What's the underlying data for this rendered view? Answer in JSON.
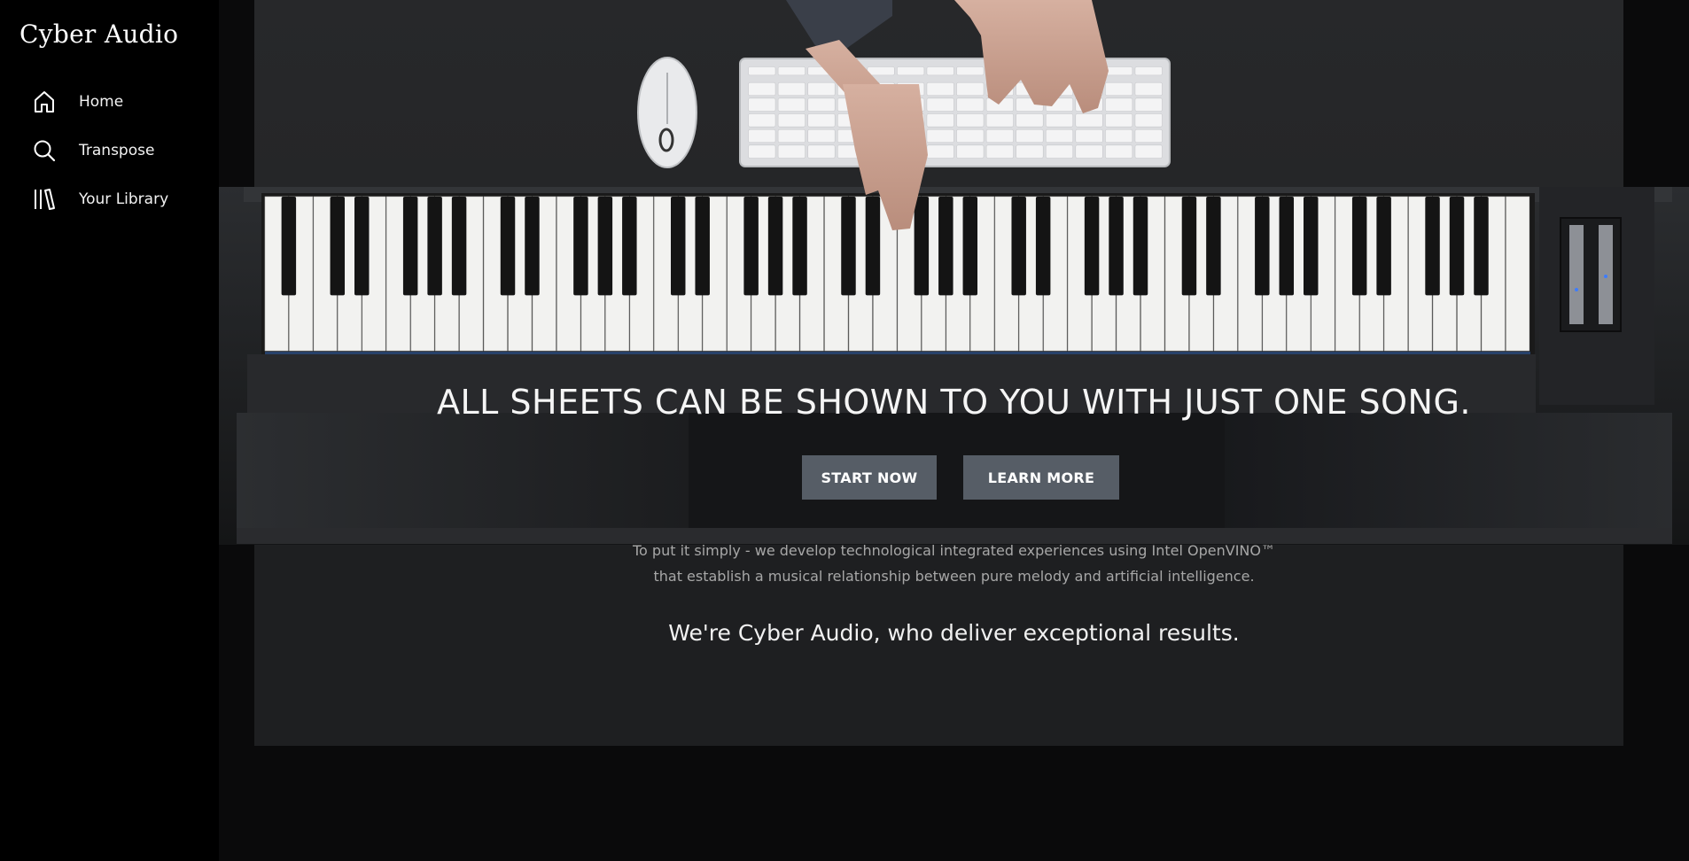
{
  "sidebar": {
    "brand": "Cyber Audio",
    "items": [
      {
        "label": "Home",
        "icon": "home-icon"
      },
      {
        "label": "Transpose",
        "icon": "search-icon"
      },
      {
        "label": "Your Library",
        "icon": "library-icon"
      }
    ]
  },
  "hero": {
    "headline": "ALL SHEETS CAN BE SHOWN TO YOU WITH JUST ONE SONG.",
    "start_label": "START NOW",
    "learn_label": "LEARN MORE",
    "description_line1": "To put it simply - we develop technological integrated experiences using Intel OpenVINO™",
    "description_line2": "that establish a musical relationship between pure melody and artificial intelligence.",
    "tagline": "We're Cyber Audio, who deliver exceptional results."
  },
  "colors": {
    "sidebar_bg": "#000000",
    "button_bg": "#565d66",
    "text_primary": "#ffffff",
    "text_muted": "#a7a7a7"
  }
}
